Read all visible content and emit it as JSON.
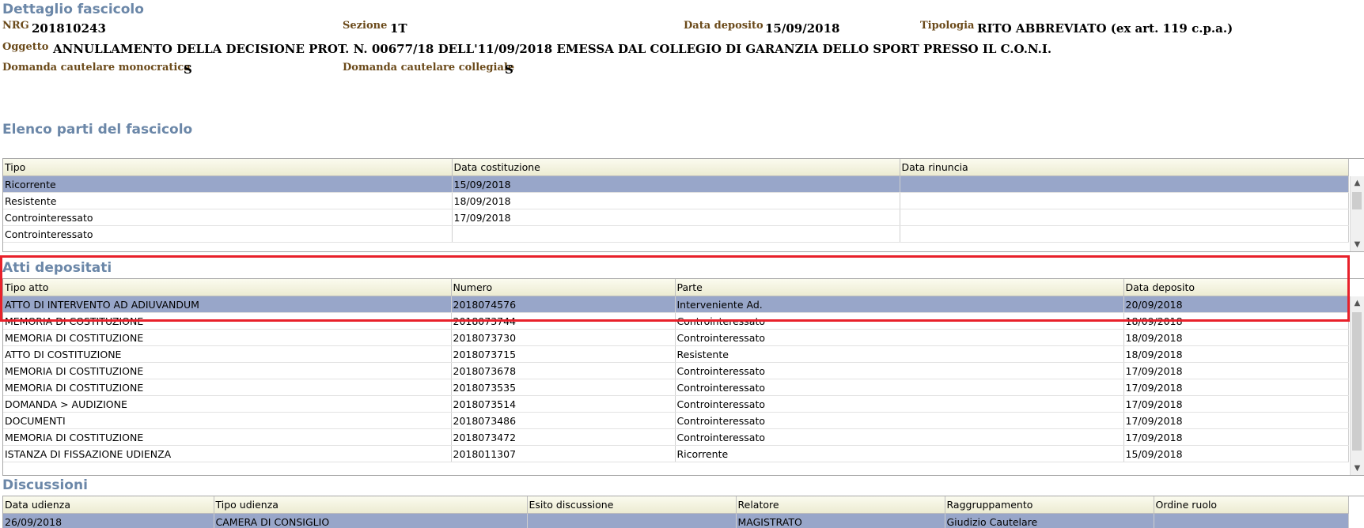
{
  "detail": {
    "title": "Dettaglio fascicolo",
    "nrg_label": "NRG",
    "nrg_value": "201810243",
    "sezione_label": "Sezione",
    "sezione_value": "1T",
    "data_deposito_label": "Data deposito",
    "data_deposito_value": "15/09/2018",
    "tipologia_label": "Tipologia",
    "tipologia_value": "RITO ABBREVIATO (ex art. 119 c.p.a.)",
    "oggetto_label": "Oggetto",
    "oggetto_value": "ANNULLAMENTO DELLA DECISIONE PROT. N. 00677/18 DELL'11/09/2018 EMESSA DAL COLLEGIO DI GARANZIA DELLO SPORT PRESSO IL C.O.N.I.",
    "monocratica_label": "Domanda cautelare monocratica",
    "monocratica_value": "S",
    "collegiale_label": "Domanda cautelare collegiale",
    "collegiale_value": "S"
  },
  "parti": {
    "title": "Elenco parti del fascicolo",
    "columns": [
      "Tipo",
      "Data costituzione",
      "Data rinuncia"
    ],
    "rows": [
      [
        "Ricorrente",
        "15/09/2018",
        ""
      ],
      [
        "Resistente",
        "18/09/2018",
        ""
      ],
      [
        "Controinteressato",
        "17/09/2018",
        ""
      ],
      [
        "Controinteressato",
        "",
        ""
      ]
    ]
  },
  "atti": {
    "title": "Atti depositati",
    "columns": [
      "Tipo atto",
      "Numero",
      "Parte",
      "Data deposito"
    ],
    "rows": [
      [
        "ATTO DI INTERVENTO AD ADIUVANDUM",
        "2018074576",
        "Interveniente Ad.",
        "20/09/2018"
      ],
      [
        "MEMORIA DI COSTITUZIONE",
        "2018073744",
        "Controinteressato",
        "18/09/2018"
      ],
      [
        "MEMORIA DI COSTITUZIONE",
        "2018073730",
        "Controinteressato",
        "18/09/2018"
      ],
      [
        "ATTO DI COSTITUZIONE",
        "2018073715",
        "Resistente",
        "18/09/2018"
      ],
      [
        "MEMORIA DI COSTITUZIONE",
        "2018073678",
        "Controinteressato",
        "17/09/2018"
      ],
      [
        "MEMORIA DI COSTITUZIONE",
        "2018073535",
        "Controinteressato",
        "17/09/2018"
      ],
      [
        "DOMANDA > AUDIZIONE",
        "2018073514",
        "Controinteressato",
        "17/09/2018"
      ],
      [
        "DOCUMENTI",
        "2018073486",
        "Controinteressato",
        "17/09/2018"
      ],
      [
        "MEMORIA DI COSTITUZIONE",
        "2018073472",
        "Controinteressato",
        "17/09/2018"
      ],
      [
        "ISTANZA DI FISSAZIONE UDIENZA",
        "2018011307",
        "Ricorrente",
        "15/09/2018"
      ]
    ]
  },
  "discussioni": {
    "title": "Discussioni",
    "columns": [
      "Data udienza",
      "Tipo udienza",
      "Esito discussione",
      "Relatore",
      "Raggruppamento",
      "Ordine ruolo"
    ],
    "rows": [
      [
        "26/09/2018",
        "CAMERA DI CONSIGLIO",
        "",
        "MAGISTRATO",
        "Giudizio Cautelare",
        ""
      ]
    ]
  },
  "icons": {
    "scroll_up": "scroll-up-icon",
    "scroll_down": "scroll-down-icon"
  },
  "colors": {
    "selected_row": "#98a6c9",
    "section_title": "#6b87a8",
    "highlight": "#e8202a"
  }
}
